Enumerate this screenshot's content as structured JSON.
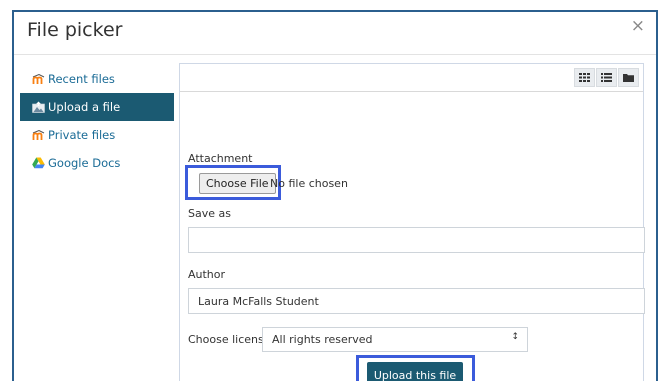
{
  "dialog": {
    "title": "File picker",
    "close_glyph": "×"
  },
  "sidebar": {
    "items": [
      {
        "label": "Recent files",
        "icon": "moodle-icon",
        "active": false
      },
      {
        "label": "Upload a file",
        "icon": "upload-icon",
        "active": true
      },
      {
        "label": "Private files",
        "icon": "moodle-icon",
        "active": false
      },
      {
        "label": "Google Docs",
        "icon": "google-drive-icon",
        "active": false
      }
    ]
  },
  "toolbar": {
    "views": [
      "grid-view-icon",
      "list-view-icon",
      "folder-view-icon"
    ]
  },
  "form": {
    "attachment_label": "Attachment",
    "choose_file_label": "Choose File",
    "no_file_text": "No file chosen",
    "save_as_label": "Save as",
    "save_as_value": "",
    "author_label": "Author",
    "author_value": "Laura McFalls Student",
    "license_label": "Choose license",
    "license_value": "All rights reserved",
    "upload_button_label": "Upload this file"
  },
  "colors": {
    "accent": "#1b5a72",
    "link": "#1a6b96",
    "highlight": "#3b5bdb",
    "dialog_border": "#2b5f8e"
  }
}
